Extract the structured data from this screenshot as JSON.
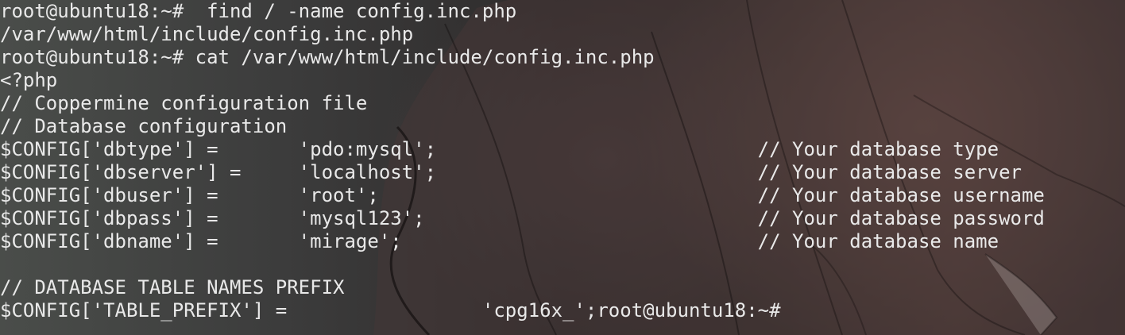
{
  "terminal": {
    "lines": [
      "root@ubuntu18:~#  find / -name config.inc.php",
      "/var/www/html/include/config.inc.php",
      "root@ubuntu18:~# cat /var/www/html/include/config.inc.php",
      "<?php",
      "// Coppermine configuration file",
      "// Database configuration",
      "$CONFIG['dbtype'] =       'pdo:mysql';                            // Your database type",
      "$CONFIG['dbserver'] =     'localhost';                            // Your database server",
      "$CONFIG['dbuser'] =       'root';                                 // Your database username",
      "$CONFIG['dbpass'] =       'mysql123';                             // Your database password",
      "$CONFIG['dbname'] =       'mirage';                               // Your database name",
      "",
      "// DATABASE TABLE NAMES PREFIX",
      "$CONFIG['TABLE_PREFIX'] =                 'cpg16x_';root@ubuntu18:~#"
    ]
  },
  "colors": {
    "text": "#e9e9e9",
    "background": "#1f1f1f"
  }
}
